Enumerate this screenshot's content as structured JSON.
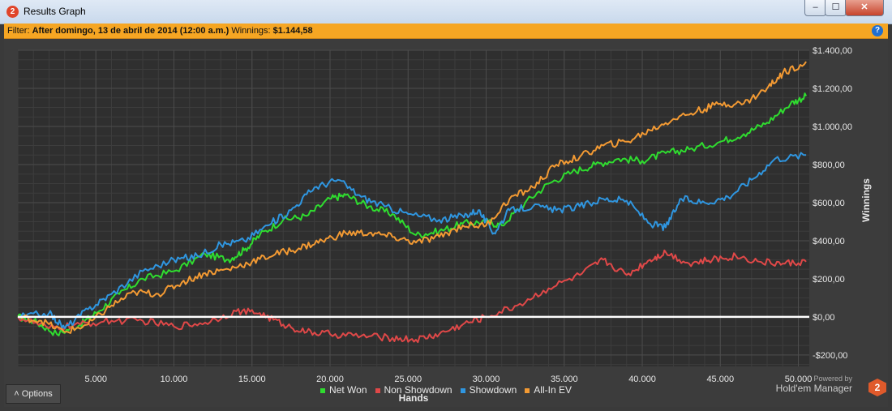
{
  "window": {
    "title": "Results Graph",
    "app_icon": "2",
    "min_glyph": "–",
    "max_glyph": "☐",
    "close_glyph": "✕"
  },
  "filter": {
    "label": "Filter:",
    "text": "After domingo, 13 de abril de 2014 (12:00 a.m.)",
    "winnings_label": "Winnings:",
    "winnings_value": "$1.144,58",
    "help_glyph": "?"
  },
  "options_label": "Options",
  "brand": {
    "powered_by": "Powered by",
    "name": "Hold'em Manager",
    "logo_text": "2"
  },
  "colors": {
    "net_won": "#2fdc2f",
    "non_showdown": "#e04848",
    "showdown": "#2f96e0",
    "all_in_ev": "#f39a33",
    "zero_line": "#ffffff",
    "accent": "#f6a623"
  },
  "chart_data": {
    "type": "line",
    "xlabel": "Hands",
    "ylabel": "Winnings",
    "xlim": [
      0,
      50700
    ],
    "ylim": [
      -260,
      1400
    ],
    "x_ticks": [
      5000,
      10000,
      15000,
      20000,
      25000,
      30000,
      35000,
      40000,
      45000,
      50000
    ],
    "x_tick_labels": [
      "5.000",
      "10.000",
      "15.000",
      "20.000",
      "25.000",
      "30.000",
      "35.000",
      "40.000",
      "45.000",
      "50.000"
    ],
    "y_ticks": [
      -200,
      0,
      200,
      400,
      600,
      800,
      1000,
      1200,
      1400
    ],
    "y_tick_labels": [
      "-$200,00",
      "$0,00",
      "$200,00",
      "$400,00",
      "$600,00",
      "$800,00",
      "$1.000,00",
      "$1.200,00",
      "$1.400,00"
    ],
    "grid": true,
    "legend_position": "bottom",
    "series": [
      {
        "name": "Net Won",
        "color": "#2fdc2f",
        "points": [
          [
            0,
            0
          ],
          [
            1000,
            -20
          ],
          [
            2500,
            -90
          ],
          [
            4000,
            -40
          ],
          [
            5000,
            20
          ],
          [
            6500,
            120
          ],
          [
            8000,
            200
          ],
          [
            10000,
            240
          ],
          [
            12000,
            330
          ],
          [
            13500,
            300
          ],
          [
            14500,
            350
          ],
          [
            15500,
            430
          ],
          [
            17000,
            510
          ],
          [
            18500,
            530
          ],
          [
            20000,
            620
          ],
          [
            21000,
            640
          ],
          [
            22500,
            580
          ],
          [
            24000,
            540
          ],
          [
            25500,
            430
          ],
          [
            27000,
            450
          ],
          [
            28500,
            490
          ],
          [
            30000,
            500
          ],
          [
            31000,
            480
          ],
          [
            32500,
            600
          ],
          [
            34000,
            700
          ],
          [
            35500,
            760
          ],
          [
            37000,
            800
          ],
          [
            38500,
            830
          ],
          [
            40000,
            820
          ],
          [
            41500,
            860
          ],
          [
            43000,
            880
          ],
          [
            45000,
            920
          ],
          [
            46500,
            960
          ],
          [
            48000,
            1020
          ],
          [
            49500,
            1120
          ],
          [
            50500,
            1160
          ]
        ]
      },
      {
        "name": "Non Showdown",
        "color": "#e04848",
        "points": [
          [
            0,
            0
          ],
          [
            2000,
            -60
          ],
          [
            4000,
            -40
          ],
          [
            6000,
            -20
          ],
          [
            8000,
            -20
          ],
          [
            10000,
            -50
          ],
          [
            12000,
            -30
          ],
          [
            14000,
            30
          ],
          [
            15500,
            20
          ],
          [
            17000,
            -40
          ],
          [
            18500,
            -80
          ],
          [
            20000,
            -90
          ],
          [
            22000,
            -100
          ],
          [
            24000,
            -110
          ],
          [
            25500,
            -120
          ],
          [
            27000,
            -90
          ],
          [
            28500,
            -40
          ],
          [
            30000,
            0
          ],
          [
            32000,
            60
          ],
          [
            34000,
            150
          ],
          [
            36000,
            220
          ],
          [
            37500,
            300
          ],
          [
            39000,
            220
          ],
          [
            40500,
            300
          ],
          [
            41500,
            340
          ],
          [
            43000,
            280
          ],
          [
            44500,
            300
          ],
          [
            46000,
            320
          ],
          [
            47500,
            290
          ],
          [
            49000,
            280
          ],
          [
            50500,
            290
          ]
        ]
      },
      {
        "name": "Showdown",
        "color": "#2f96e0",
        "points": [
          [
            0,
            0
          ],
          [
            2000,
            20
          ],
          [
            3000,
            -60
          ],
          [
            4500,
            40
          ],
          [
            6000,
            120
          ],
          [
            8000,
            240
          ],
          [
            10000,
            300
          ],
          [
            11500,
            320
          ],
          [
            13000,
            380
          ],
          [
            14500,
            400
          ],
          [
            16000,
            480
          ],
          [
            17500,
            560
          ],
          [
            19000,
            680
          ],
          [
            20500,
            720
          ],
          [
            22000,
            630
          ],
          [
            23500,
            580
          ],
          [
            25000,
            540
          ],
          [
            27000,
            510
          ],
          [
            28500,
            530
          ],
          [
            29500,
            560
          ],
          [
            30500,
            440
          ],
          [
            31500,
            560
          ],
          [
            33000,
            580
          ],
          [
            34500,
            560
          ],
          [
            36000,
            580
          ],
          [
            37500,
            620
          ],
          [
            39000,
            610
          ],
          [
            40500,
            490
          ],
          [
            41500,
            470
          ],
          [
            42500,
            620
          ],
          [
            44000,
            600
          ],
          [
            45500,
            630
          ],
          [
            47000,
            720
          ],
          [
            48500,
            830
          ],
          [
            50500,
            850
          ]
        ]
      },
      {
        "name": "All-In EV",
        "color": "#f39a33",
        "points": [
          [
            0,
            0
          ],
          [
            1500,
            -20
          ],
          [
            3000,
            -80
          ],
          [
            4500,
            -40
          ],
          [
            6000,
            60
          ],
          [
            7500,
            130
          ],
          [
            9000,
            120
          ],
          [
            10500,
            180
          ],
          [
            12000,
            230
          ],
          [
            13500,
            250
          ],
          [
            15000,
            290
          ],
          [
            16500,
            330
          ],
          [
            18000,
            360
          ],
          [
            19500,
            400
          ],
          [
            21000,
            440
          ],
          [
            22500,
            440
          ],
          [
            24000,
            420
          ],
          [
            25500,
            390
          ],
          [
            27000,
            420
          ],
          [
            28500,
            480
          ],
          [
            30000,
            480
          ],
          [
            31500,
            620
          ],
          [
            33000,
            680
          ],
          [
            34500,
            800
          ],
          [
            36000,
            840
          ],
          [
            37500,
            900
          ],
          [
            39000,
            920
          ],
          [
            40500,
            980
          ],
          [
            42000,
            1040
          ],
          [
            43500,
            1080
          ],
          [
            45000,
            1120
          ],
          [
            46500,
            1120
          ],
          [
            48000,
            1200
          ],
          [
            49000,
            1280
          ],
          [
            50500,
            1340
          ]
        ]
      }
    ]
  }
}
